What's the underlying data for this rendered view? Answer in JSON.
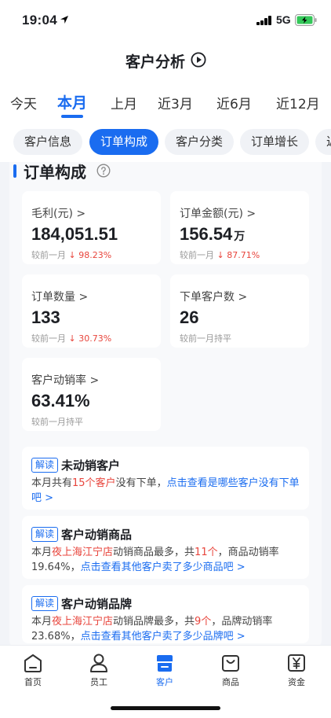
{
  "status_bar": {
    "time": "19:04",
    "network": "5G"
  },
  "header": {
    "title": "客户分析"
  },
  "period_tabs": [
    {
      "label": "今天",
      "active": false
    },
    {
      "label": "本月",
      "active": true
    },
    {
      "label": "上月",
      "active": false
    },
    {
      "label": "近3月",
      "active": false
    },
    {
      "label": "近6月",
      "active": false
    },
    {
      "label": "近12月",
      "active": false
    }
  ],
  "category_tabs": [
    {
      "label": "客户信息",
      "active": false
    },
    {
      "label": "订单构成",
      "active": true
    },
    {
      "label": "客户分类",
      "active": false
    },
    {
      "label": "订单增长",
      "active": false
    },
    {
      "label": "近",
      "active": false
    }
  ],
  "section": {
    "title": "订单构成"
  },
  "metrics": [
    {
      "label": "毛利(元) >",
      "value": "184,051.51",
      "unit": "",
      "compare_prefix": "较前一月",
      "change": "↓ 98.23%"
    },
    {
      "label": "订单金额(元) >",
      "value": "156.54",
      "unit": "万",
      "compare_prefix": "较前一月",
      "change": "↓ 87.71%"
    },
    {
      "label": "订单数量 >",
      "value": "133",
      "unit": "",
      "compare_prefix": "较前一月",
      "change": "↓ 30.73%"
    },
    {
      "label": "下单客户数 >",
      "value": "26",
      "unit": "",
      "compare_prefix": "较前一月持平",
      "change": ""
    },
    {
      "label": "客户动销率 >",
      "value": "63.41%",
      "unit": "",
      "compare_prefix": "较前一月持平",
      "change": ""
    }
  ],
  "insights": [
    {
      "tag": "解读",
      "title": "未动销客户",
      "parts": [
        {
          "text": "本月共有",
          "style": "plain"
        },
        {
          "text": "15个客户",
          "style": "red"
        },
        {
          "text": "没有下单，",
          "style": "plain"
        },
        {
          "text": "点击查看是哪些客户没有下单吧 >",
          "style": "blue"
        }
      ]
    },
    {
      "tag": "解读",
      "title": "客户动销商品",
      "parts": [
        {
          "text": "本月",
          "style": "plain"
        },
        {
          "text": "夜上海江宁店",
          "style": "red"
        },
        {
          "text": "动销商品最多，共",
          "style": "plain"
        },
        {
          "text": "11个",
          "style": "red"
        },
        {
          "text": "，商品动销率19.64%，",
          "style": "plain"
        },
        {
          "text": "点击查看其他客户卖了多少商品吧 >",
          "style": "blue"
        }
      ]
    },
    {
      "tag": "解读",
      "title": "客户动销品牌",
      "parts": [
        {
          "text": "本月",
          "style": "plain"
        },
        {
          "text": "夜上海江宁店",
          "style": "red"
        },
        {
          "text": "动销品牌最多，共",
          "style": "plain"
        },
        {
          "text": "9个",
          "style": "red"
        },
        {
          "text": "，品牌动销率23.68%，",
          "style": "plain"
        },
        {
          "text": "点击查看其他客户卖了多少品牌吧 >",
          "style": "blue"
        }
      ]
    }
  ],
  "bottom_nav": [
    {
      "label": "首页",
      "icon": "home-icon",
      "active": false
    },
    {
      "label": "员工",
      "icon": "person-icon",
      "active": false
    },
    {
      "label": "客户",
      "icon": "store-icon",
      "active": true
    },
    {
      "label": "商品",
      "icon": "bag-icon",
      "active": false
    },
    {
      "label": "资金",
      "icon": "yuan-icon",
      "active": false
    }
  ],
  "colors": {
    "accent": "#1a6cf0",
    "down": "#e8453c"
  }
}
